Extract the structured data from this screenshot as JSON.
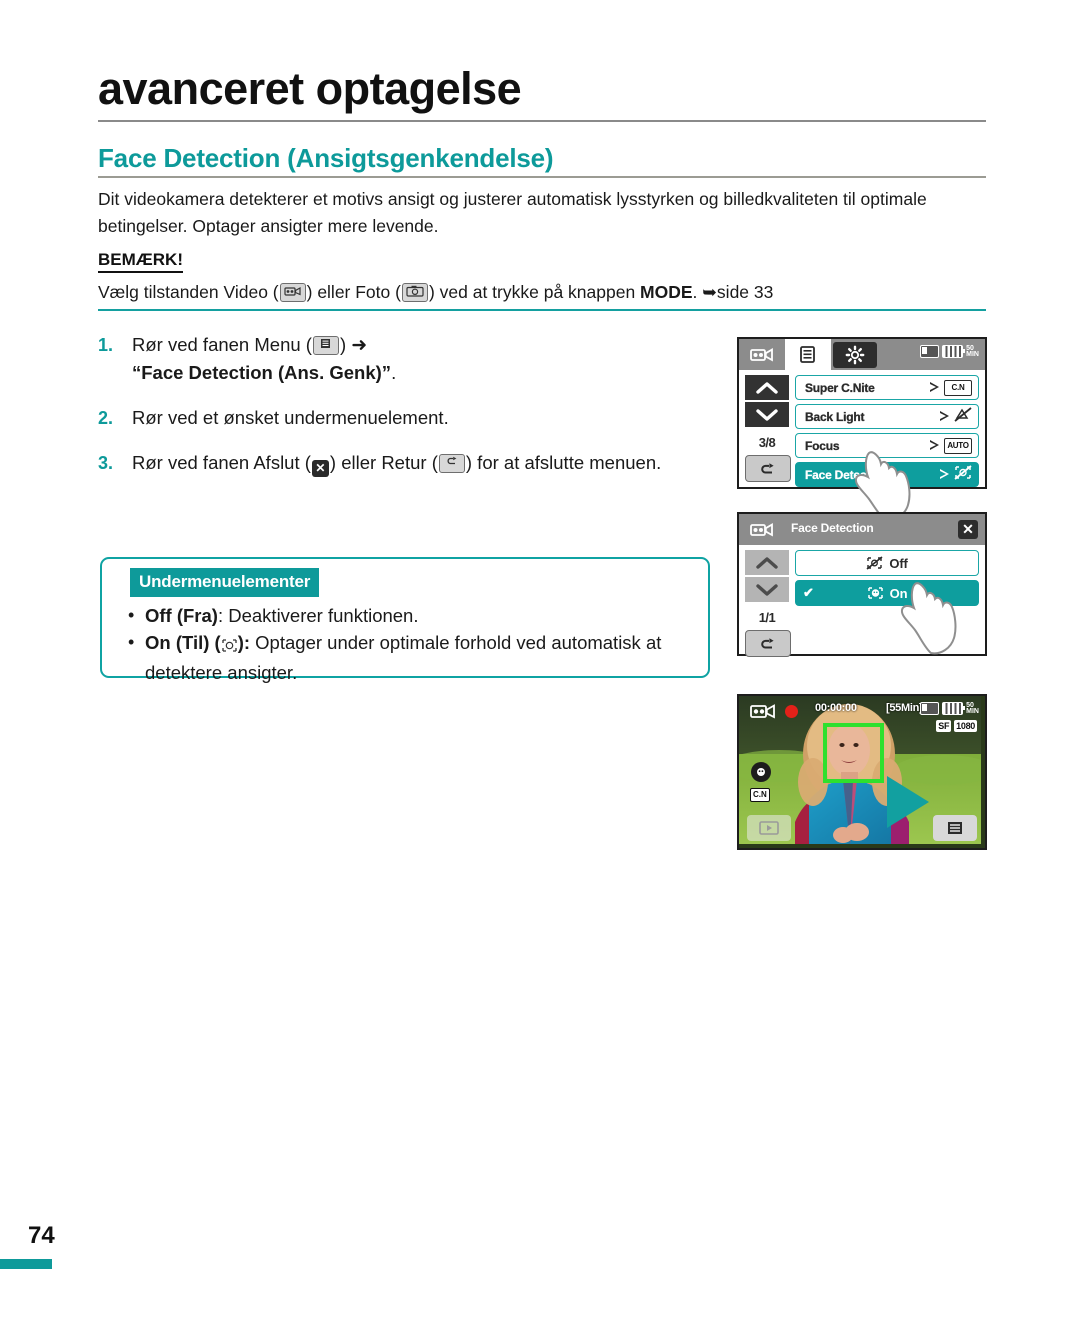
{
  "document": {
    "chapter_title": "avanceret optagelse",
    "section_title": "Face Detection (Ansigtsgenkendelse)",
    "intro": "Dit videokamera detekterer et motivs ansigt og justerer automatisk lysstyrken og billedkvaliteten til optimale betingelser. Optager ansigter mere levende.",
    "note_label": "BEMÆRK!",
    "note_pre": "Vælg tilstanden Video (",
    "note_mid": ") eller Foto (",
    "note_post": ") ved at trykke på knappen ",
    "note_mode": "MODE",
    "note_ref": ". ➥side 33",
    "page_number": "74"
  },
  "steps": [
    {
      "num": "1.",
      "pre": "Rør ved fanen Menu (",
      "post": ") ",
      "arrow": "➜",
      "bold_line": "“Face Detection (Ans. Genk)”",
      "trailing": "."
    },
    {
      "num": "2.",
      "text": "Rør ved et ønsket undermenuelement."
    },
    {
      "num": "3.",
      "pre": "Rør ved fanen Afslut (",
      "mid": ") eller Retur (",
      "post": ") for at afslutte menuen."
    }
  ],
  "submenu": {
    "badge": "Undermenuelementer",
    "items": [
      {
        "bullet": "•",
        "bold": "Off (Fra)",
        "rest": ": Deaktiverer funktionen."
      },
      {
        "bullet": "•",
        "bold": "On (Til) (",
        "bold_tail": "):",
        "rest": " Optager under optimale forhold ved automatisk at detektere ansigter."
      }
    ]
  },
  "screen_menu": {
    "status": {
      "minutes": "50",
      "min_unit": "MIN"
    },
    "page_indicator": "3/8",
    "rows": [
      {
        "label": "Super C.Nite",
        "value": "C.N",
        "value_type": "text"
      },
      {
        "label": "Back Light",
        "value": "",
        "value_type": "icon-backlight"
      },
      {
        "label": "Focus",
        "value": "AUTO",
        "value_type": "text"
      },
      {
        "label": "Face Detection",
        "value": "",
        "value_type": "icon-face-off",
        "selected": true
      }
    ]
  },
  "screen_submenu": {
    "title": "Face Detection",
    "page_indicator": "1/1",
    "close_label": "✕",
    "options": [
      {
        "label": "Off",
        "selected": false
      },
      {
        "label": "On",
        "selected": true,
        "check": "✔"
      }
    ]
  },
  "screen_preview": {
    "timecode": "00:00:00",
    "remaining": "[55Min]",
    "minutes": "50",
    "min_unit": "MIN",
    "quality": "SF",
    "resolution": "1080",
    "cn_badge": "C.N"
  },
  "colors": {
    "teal": "#0d9a9a",
    "teal_row": "#0e9e9e",
    "teal_border": "#0fa3a3",
    "face_box_green": "#2ee02e",
    "rec_red": "#e32119"
  }
}
